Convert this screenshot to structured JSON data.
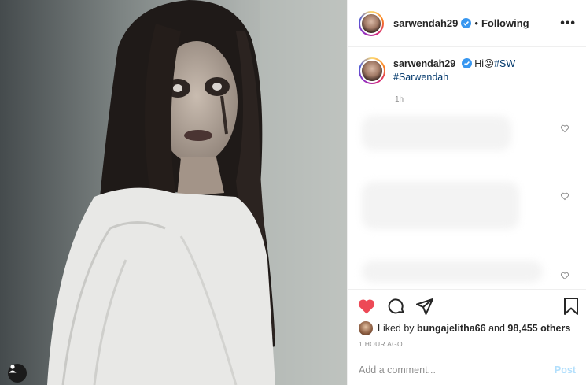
{
  "post": {
    "username": "sarwendah29",
    "verified": true,
    "follow_separator": "•",
    "follow_status": "Following",
    "more_label": "•••",
    "caption": {
      "username": "sarwendah29",
      "text_prefix": "Hi",
      "emoji": "😜",
      "hashtags": [
        "#SW",
        "#Sarwendah"
      ],
      "time": "1h"
    },
    "likes": {
      "prefix": "Liked by",
      "user": "bungajelitha66",
      "and": "and",
      "count": "98,455 others"
    },
    "timestamp": "1 HOUR AGO",
    "comment": {
      "placeholder": "Add a comment...",
      "post_label": "Post"
    }
  },
  "icons": {
    "like": "heart-filled-icon",
    "comment": "comment-icon",
    "share": "paper-plane-icon",
    "save": "bookmark-icon",
    "comment_like": "heart-outline-icon",
    "tagged_user": "user-tag-icon",
    "verified": "verified-badge-icon"
  },
  "colors": {
    "like_red": "#ed4956",
    "verified_blue": "#3897f0",
    "hashtag": "#00376b",
    "post_disabled": "#b2dffc",
    "muted": "#8e8e8e"
  }
}
